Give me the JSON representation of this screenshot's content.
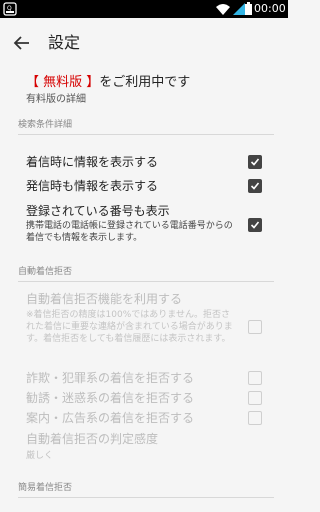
{
  "statusbar": {
    "time": "00:00"
  },
  "appbar": {
    "title": "設定"
  },
  "plan": {
    "bracket_open": "【 ",
    "plan_name": "無料版",
    "bracket_close": " 】",
    "suffix": "をご利用中です",
    "details_link": "有料版の詳細"
  },
  "sections": {
    "search": {
      "header": "検索条件詳細"
    },
    "auto_reject": {
      "header": "自動着信拒否"
    },
    "simple_reject": {
      "header": "簡易着信拒否"
    }
  },
  "settings": {
    "incoming_info": {
      "label": "着信時に情報を表示する",
      "checked": true
    },
    "outgoing_info": {
      "label": "発信時も情報を表示する",
      "checked": true
    },
    "registered_numbers": {
      "label": "登録されている番号も表示",
      "desc": "携帯電話の電話帳に登録されている電話番号からの着信でも情報を表示します。",
      "checked": true
    },
    "auto_reject_enable": {
      "label": "自動着信拒否機能を利用する",
      "desc": "※着信拒否の精度は100%ではありません。拒否された着信に重要な連絡が含まれている場合があります。着信拒否をしても着信履歴には表示されます。",
      "checked": false
    },
    "reject_fraud": {
      "label": "詐欺・犯罪系の着信を拒否する",
      "checked": false
    },
    "reject_solicit": {
      "label": "勧誘・迷惑系の着信を拒否する",
      "checked": false
    },
    "reject_ads": {
      "label": "案内・広告系の着信を拒否する",
      "checked": false
    },
    "reject_sensitivity": {
      "label": "自動着信拒否の判定感度",
      "value": "厳しく"
    }
  },
  "colors": {
    "accent_red": "#d60000",
    "checkbox_on": "#444444",
    "disabled_text": "#bdbdbd"
  }
}
